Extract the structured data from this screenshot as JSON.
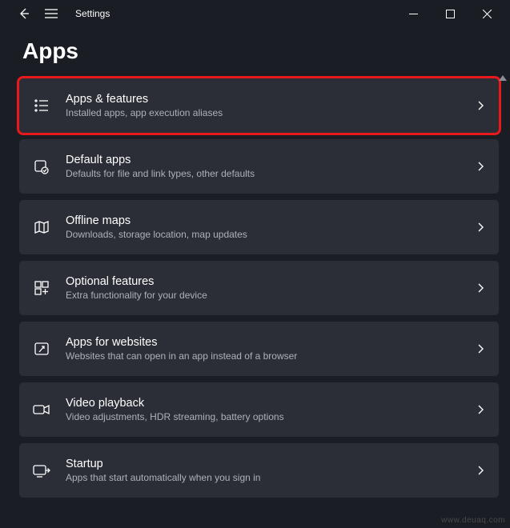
{
  "titlebar": {
    "title": "Settings"
  },
  "page": {
    "heading": "Apps"
  },
  "items": [
    {
      "title": "Apps & features",
      "subtitle": "Installed apps, app execution aliases"
    },
    {
      "title": "Default apps",
      "subtitle": "Defaults for file and link types, other defaults"
    },
    {
      "title": "Offline maps",
      "subtitle": "Downloads, storage location, map updates"
    },
    {
      "title": "Optional features",
      "subtitle": "Extra functionality for your device"
    },
    {
      "title": "Apps for websites",
      "subtitle": "Websites that can open in an app instead of a browser"
    },
    {
      "title": "Video playback",
      "subtitle": "Video adjustments, HDR streaming, battery options"
    },
    {
      "title": "Startup",
      "subtitle": "Apps that start automatically when you sign in"
    }
  ],
  "watermark": "www.deuaq.com"
}
